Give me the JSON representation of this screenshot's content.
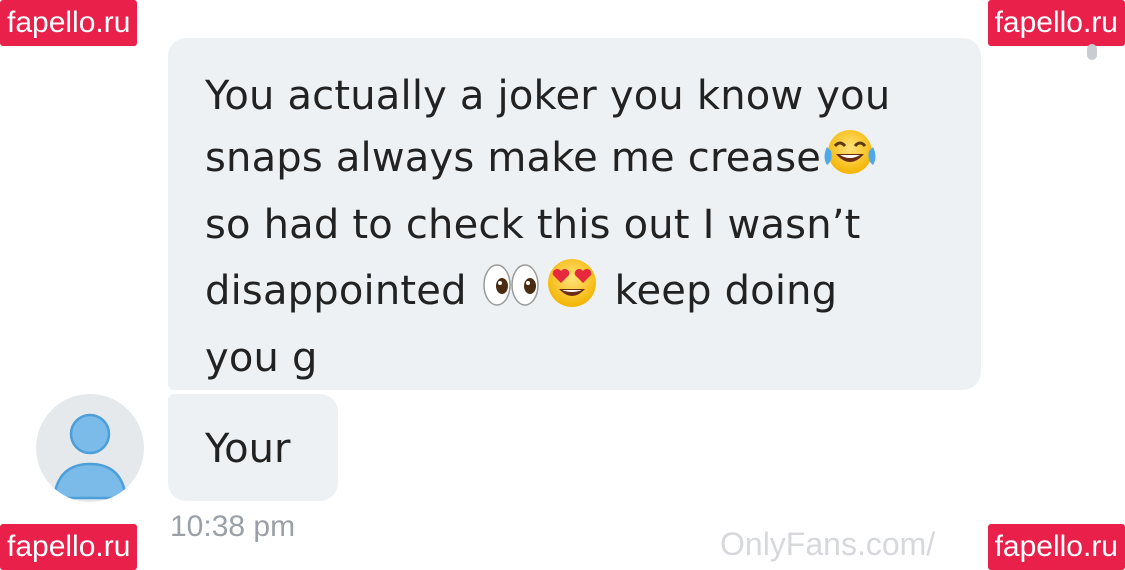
{
  "messages": {
    "first": {
      "lines": [
        "You actually a joker you know you",
        "snaps always make me crease",
        "so had to check this out I wasn’t",
        "disappointed",
        "keep doing",
        "you g"
      ],
      "emoji_laugh": "face-with-tears-of-joy-emoji",
      "emoji_eyes": "eyes-emoji",
      "emoji_heart_eyes": "heart-eyes-emoji"
    },
    "second": {
      "text": "Your"
    },
    "timestamp": "10:38 pm"
  },
  "watermarks": {
    "corner": "fapello.ru",
    "site": "OnlyFans.com/"
  },
  "colors": {
    "bubble": "#eef1f3",
    "avatar_bg": "#e6e9ec",
    "avatar_fg": "#6fb4e8",
    "watermark_bg": "#e8204a"
  }
}
